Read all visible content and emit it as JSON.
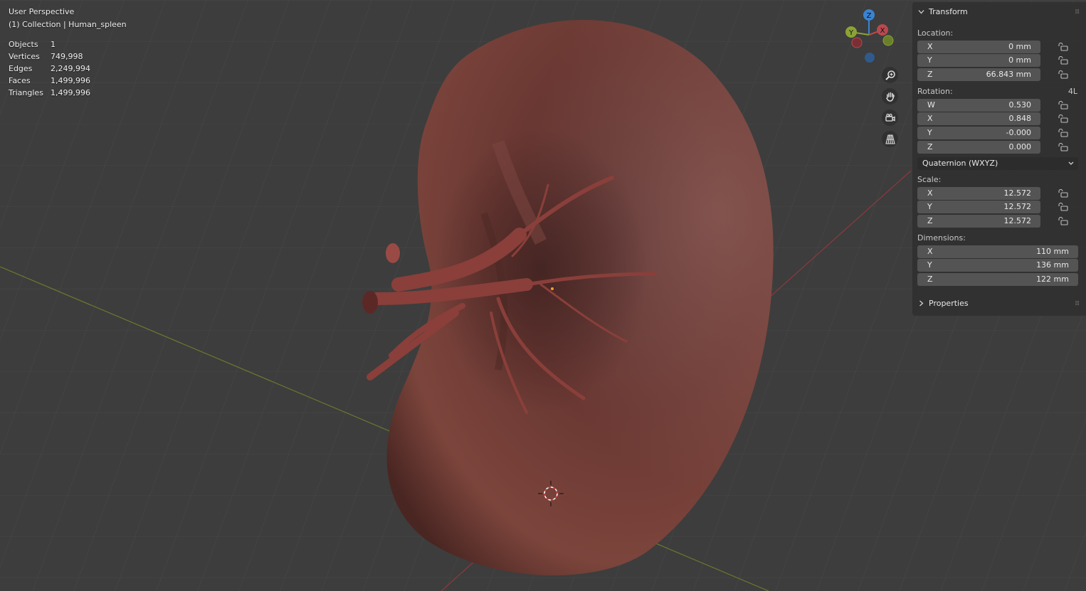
{
  "viewport": {
    "view_name": "User Perspective",
    "collection_line": "(1) Collection | Human_spleen",
    "stats": [
      {
        "label": "Objects",
        "value": "1"
      },
      {
        "label": "Vertices",
        "value": "749,998"
      },
      {
        "label": "Edges",
        "value": "2,249,994"
      },
      {
        "label": "Faces",
        "value": "1,499,996"
      },
      {
        "label": "Triangles",
        "value": "1,499,996"
      }
    ],
    "gizmo": {
      "z": "Z",
      "y": "Y",
      "x": "X"
    },
    "nav_tools": [
      "zoom-icon",
      "pan-hand-icon",
      "camera-icon",
      "perspective-grid-icon"
    ],
    "colors": {
      "background": "#3d3d3d",
      "x_axis": "#b8494f",
      "y_axis": "#8ba335",
      "z_axis": "#3b83d1",
      "organ": "#6e3a34"
    }
  },
  "transform_panel": {
    "title": "Transform",
    "location": {
      "label": "Location:",
      "x": {
        "axis": "X",
        "value": "0 mm"
      },
      "y": {
        "axis": "Y",
        "value": "0 mm"
      },
      "z": {
        "axis": "Z",
        "value": "66.843 mm"
      }
    },
    "rotation": {
      "label": "Rotation:",
      "mode_badge": "4L",
      "w": {
        "axis": "W",
        "value": "0.530"
      },
      "x": {
        "axis": "X",
        "value": "0.848"
      },
      "y": {
        "axis": "Y",
        "value": "-0.000"
      },
      "z": {
        "axis": "Z",
        "value": "0.000"
      },
      "mode": "Quaternion (WXYZ)"
    },
    "scale": {
      "label": "Scale:",
      "x": {
        "axis": "X",
        "value": "12.572"
      },
      "y": {
        "axis": "Y",
        "value": "12.572"
      },
      "z": {
        "axis": "Z",
        "value": "12.572"
      }
    },
    "dimensions": {
      "label": "Dimensions:",
      "x": {
        "axis": "X",
        "value": "110 mm"
      },
      "y": {
        "axis": "Y",
        "value": "136 mm"
      },
      "z": {
        "axis": "Z",
        "value": "122 mm"
      }
    },
    "properties_title": "Properties"
  }
}
